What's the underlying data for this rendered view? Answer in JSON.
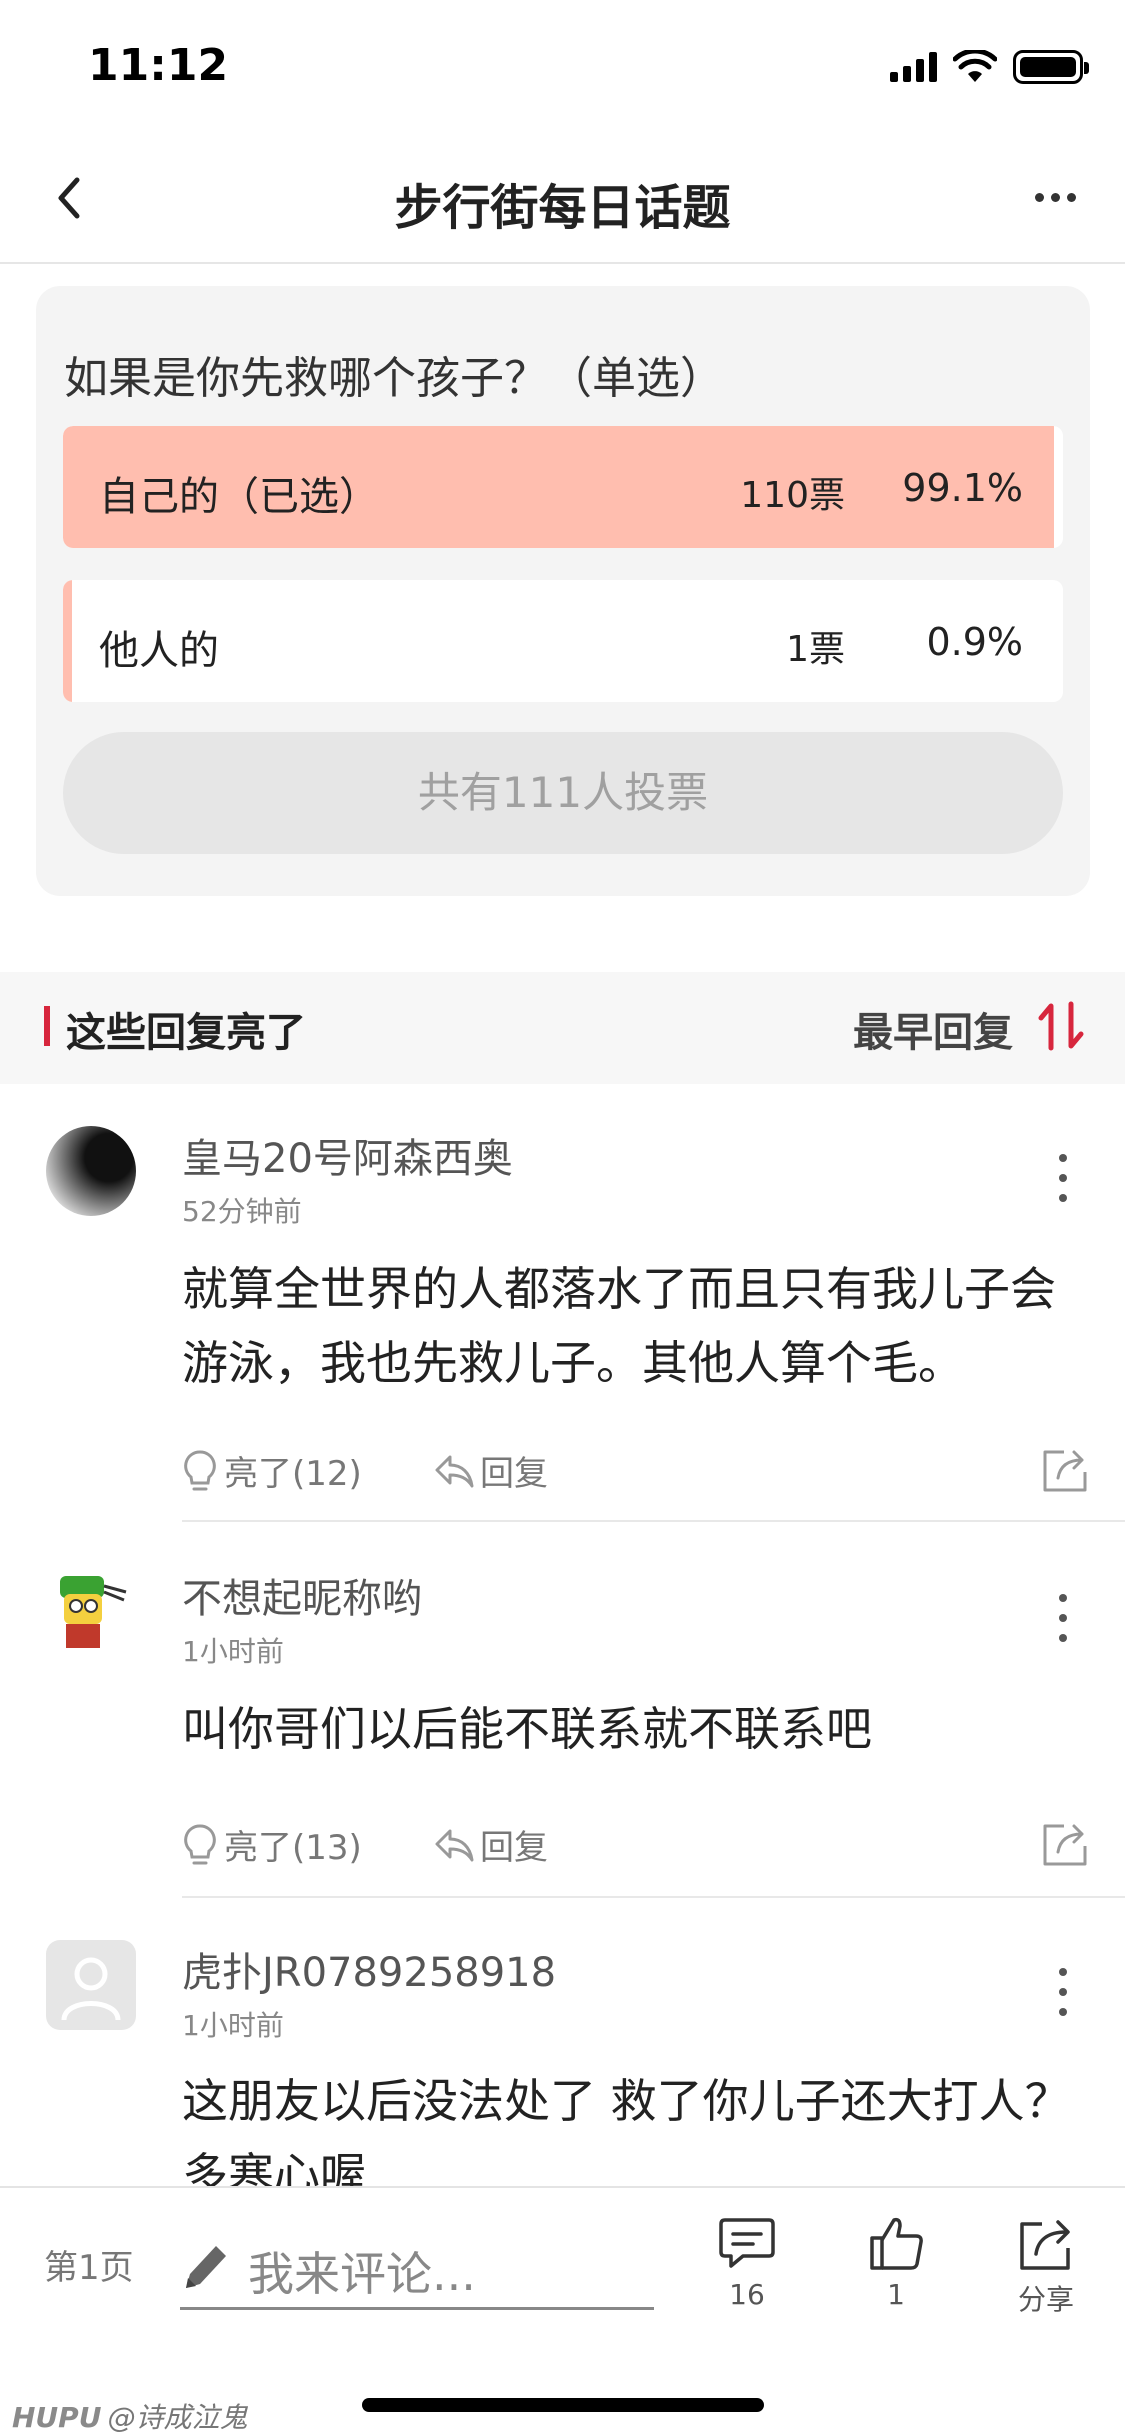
{
  "status": {
    "time": "11:12"
  },
  "nav": {
    "title": "步行街每日话题"
  },
  "poll": {
    "question": "如果是你先救哪个孩子？（单选）",
    "options": [
      {
        "label": "自己的（已选）",
        "votes": "110票",
        "percent": "99.1%",
        "share": 0.991,
        "selected": true
      },
      {
        "label": "他人的",
        "votes": "1票",
        "percent": "0.9%",
        "share": 0.009,
        "selected": false
      }
    ],
    "total": "共有111人投票",
    "selected_color": "#ffbeaf"
  },
  "section": {
    "title": "这些回复亮了",
    "sort_label": "最早回复",
    "accent_color": "#d7263d"
  },
  "comments": [
    {
      "name": "皇马20号阿森西奥",
      "time": "52分钟前",
      "content": "就算全世界的人都落水了而且只有我儿子会游泳，我也先救儿子。其他人算个毛。",
      "like_label": "亮了(12)",
      "reply_label": "回复"
    },
    {
      "name": "不想起昵称哟",
      "time": "1小时前",
      "content": "叫你哥们以后能不联系就不联系吧",
      "like_label": "亮了(13)",
      "reply_label": "回复"
    },
    {
      "name": "虎扑JR0789258918",
      "time": "1小时前",
      "content": "这朋友以后没法处了 救了你儿子还大打人？ 多寒心喔",
      "like_label": "",
      "reply_label": ""
    }
  ],
  "bottom": {
    "page_label": "第1页",
    "comment_placeholder": "我来评论...",
    "comment_count": "16",
    "like_count": "1",
    "share_label": "分享"
  },
  "watermark": {
    "brand": "HUPU",
    "handle": "@诗成泣鬼"
  }
}
